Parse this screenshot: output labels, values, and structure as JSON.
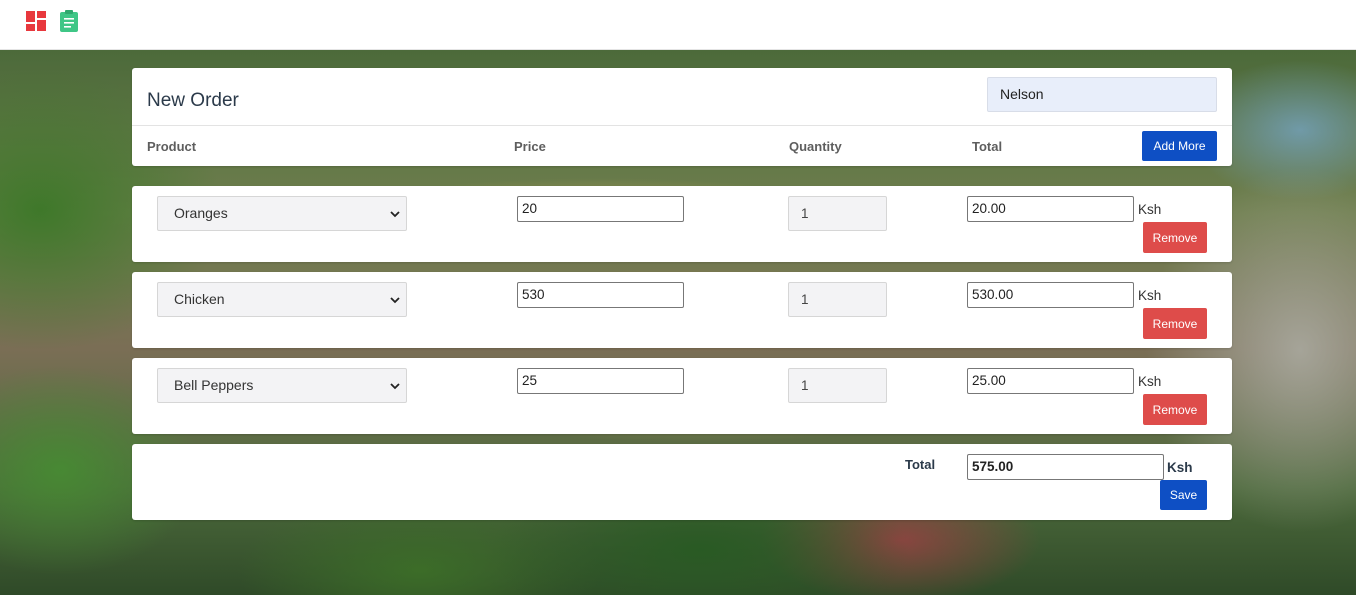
{
  "topbar": {
    "icons": [
      "dashboard-icon",
      "clipboard-icon"
    ],
    "colors": {
      "dashboard": "#e8383d",
      "clipboard": "#3fc686"
    }
  },
  "order": {
    "title": "New Order",
    "customer_value": "Nelson",
    "columns": [
      "Product",
      "Price",
      "Quantity",
      "Total"
    ],
    "add_more_label": "Add More",
    "rows": [
      {
        "product": "Oranges",
        "price": "20",
        "quantity": "1",
        "total": "20.00",
        "currency": "Ksh",
        "remove_label": "Remove"
      },
      {
        "product": "Chicken",
        "price": "530",
        "quantity": "1",
        "total": "530.00",
        "currency": "Ksh",
        "remove_label": "Remove"
      },
      {
        "product": "Bell Peppers",
        "price": "25",
        "quantity": "1",
        "total": "25.00",
        "currency": "Ksh",
        "remove_label": "Remove"
      }
    ],
    "summary": {
      "label": "Total",
      "value": "575.00",
      "currency": "Ksh",
      "save_label": "Save"
    }
  },
  "colors": {
    "primary_button": "#0e4fc4",
    "danger_button": "#de4c4a",
    "customer_field_bg": "#e8eefa"
  }
}
